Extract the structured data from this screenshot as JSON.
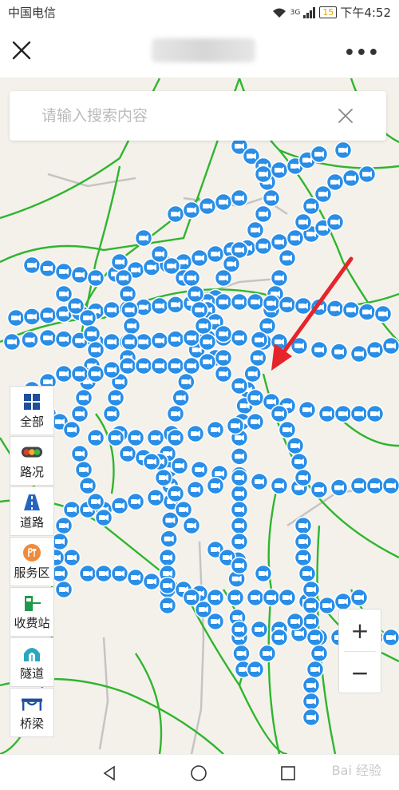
{
  "status_bar": {
    "carrier": "中国电信",
    "signal": "3G",
    "battery": "15",
    "time": "下午4:52"
  },
  "header": {
    "close_icon": "close-icon",
    "more_icon": "more-icon"
  },
  "search": {
    "placeholder": "请输入搜索内容",
    "clear_icon": "clear-icon"
  },
  "layers": [
    {
      "label": "全部",
      "icon": "grid-icon"
    },
    {
      "label": "路况",
      "icon": "traffic-light-icon"
    },
    {
      "label": "道路",
      "icon": "road-icon"
    },
    {
      "label": "服务区",
      "icon": "service-area-icon"
    },
    {
      "label": "收费站",
      "icon": "toll-station-icon"
    },
    {
      "label": "隧道",
      "icon": "tunnel-icon"
    },
    {
      "label": "桥梁",
      "icon": "bridge-icon"
    }
  ],
  "zoom": {
    "in_label": "+",
    "out_label": "−"
  },
  "map": {
    "marker_icon": "camera-icon",
    "marker_color": "#2b8ee6",
    "road_color": "#2fb52f",
    "arrow_color": "#e5252a"
  },
  "watermark": "Bai 经验"
}
